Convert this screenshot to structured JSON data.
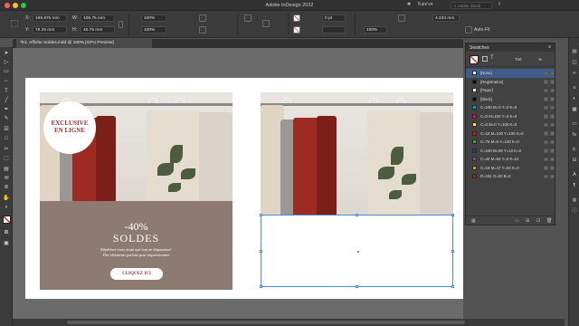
{
  "window": {
    "app_title": "Adobe InDesign 2022",
    "workspace": "Kate's",
    "search_placeholder": "Adobe Stock"
  },
  "controlbar": {
    "x_label": "X:",
    "x_value": "189.875 mm",
    "y_label": "Y:",
    "y_value": "78.25 mm",
    "w_label": "W:",
    "w_value": "109.75 mm",
    "h_label": "H:",
    "h_value": "40.75 mm",
    "scale_x": "100%",
    "scale_y": "100%",
    "stroke_weight": "0 pt",
    "opacity": "100%",
    "offset_value": "4.233 mm",
    "autofit_label": "Auto-Fit"
  },
  "document": {
    "tab_label": "*E1. Affiche Soldes.indd @ 100% [GPU Preview]"
  },
  "left_page": {
    "badge_line1": "EXCLUSIVE",
    "badge_line2": "EN LIGNE",
    "promo_percent": "-40%",
    "promo_title": "SOLDES",
    "promo_line1": "Dépêchez-vous avant que tout ne disparaisse!",
    "promo_line2": "Des vêtements parfaits pour impressionner",
    "cta_label": "CLIQUEZ ICI"
  },
  "swatches": {
    "panel_title": "Swatches",
    "tint_label": "Tint:",
    "tint_value": "%",
    "items": [
      {
        "name": "[None]",
        "color": "#ffffff",
        "selected": true
      },
      {
        "name": "[Registration]",
        "color": "#000000",
        "selected": false
      },
      {
        "name": "[Paper]",
        "color": "#ffffff",
        "selected": false
      },
      {
        "name": "[Black]",
        "color": "#000000",
        "selected": false
      },
      {
        "name": "C=100 M=0 Y=0 K=0",
        "color": "#00a0e9",
        "selected": false
      },
      {
        "name": "C=0 M=100 Y=0 K=0",
        "color": "#e4007f",
        "selected": false
      },
      {
        "name": "C=0 M=0 Y=100 K=0",
        "color": "#fff100",
        "selected": false
      },
      {
        "name": "C=15 M=100 Y=100 K=0",
        "color": "#c8161d",
        "selected": false
      },
      {
        "name": "C=75 M=5 Y=100 K=0",
        "color": "#3aa935",
        "selected": false
      },
      {
        "name": "C=100 M=90 Y=10 K=0",
        "color": "#1d3c8f",
        "selected": false
      },
      {
        "name": "C=40 M=65 Y=0 K=21",
        "color": "#7a4a8f",
        "selected": false
      },
      {
        "name": "C=19 M=47 Y=92 K=0",
        "color": "#d68f2a",
        "selected": false
      },
      {
        "name": "R=151 G=50 B=0",
        "color": "#973200",
        "selected": false
      }
    ]
  },
  "colors": {
    "promo_brown": "#8d7a71",
    "badge_red": "#a3302b",
    "selection_blue": "#4a90d9"
  }
}
